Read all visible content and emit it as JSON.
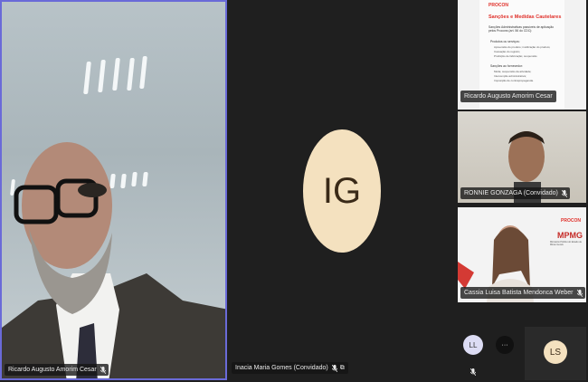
{
  "participants": {
    "main": {
      "name": "Ricardo Augusto Amorim Cesar"
    },
    "center": {
      "initials": "IG",
      "name": "Inacia Maria Gomes (Convidado)"
    },
    "slide": {
      "name": "Ricardo Augusto Amorim Cesar",
      "brand": "PROCON",
      "title": "Sanções e Medidas Cautelares",
      "subtitle": "Sanções Administrativas passíveis de aplicação pelos Procons (art. 56 do CDC):",
      "section1": "Produtos ou serviços:",
      "list1": [
        "Apreensão do produto; inutilização do produto;",
        "Cassação do registro;",
        "Proibição de fabricação; suspensão"
      ],
      "section2": "Sanções ao fornecedor:",
      "list2": [
        "Multa; suspensão da atividade;",
        "Intervenção administrativa;",
        "Imposição de contrapropaganda."
      ]
    },
    "ronnie": {
      "name": "RONNIE GONZAGA (Convidado)"
    },
    "cassia": {
      "name": "Cassia Luisa Batista Mendonca Weber",
      "brand": "PROCON",
      "org": "MPMG",
      "org_sub": "Ministério Público do Estado de Minas Gerais"
    },
    "bottom": [
      {
        "initials": "LL"
      },
      {
        "initials": "···"
      },
      {
        "initials": "LS"
      }
    ]
  },
  "colors": {
    "accent_border": "#6a6ad8",
    "avatar_bg": "#f4e1bf",
    "brand_red": "#e0302a"
  }
}
